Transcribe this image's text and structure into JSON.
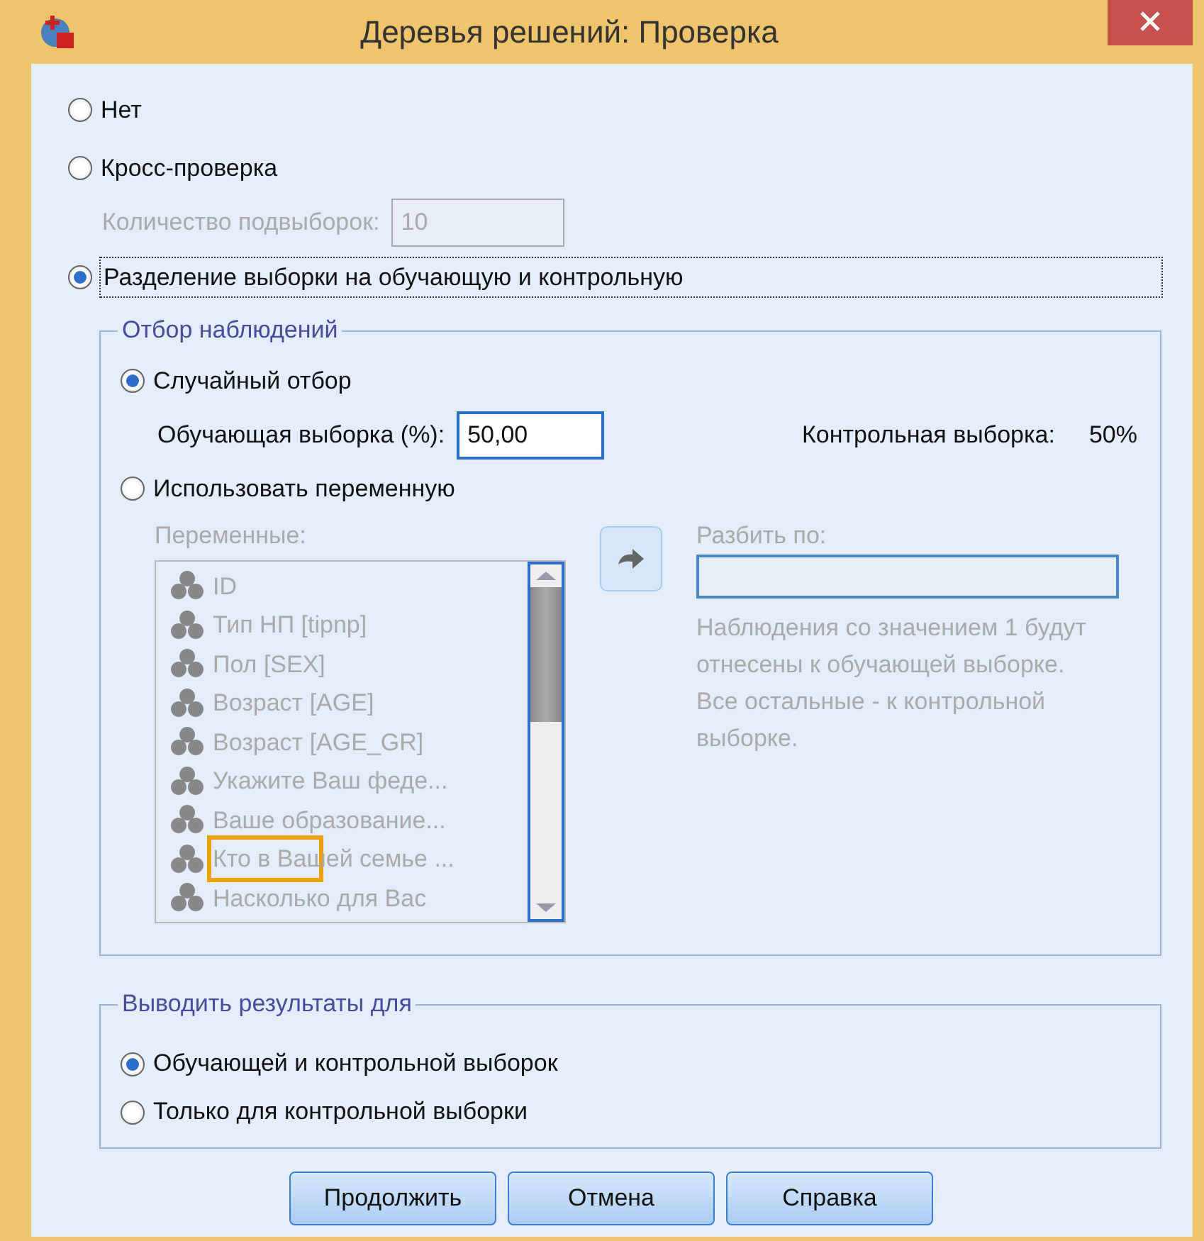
{
  "window": {
    "title": "Деревья решений: Проверка"
  },
  "validation": {
    "options": [
      {
        "label": "Нет",
        "selected": false
      },
      {
        "label": "Кросс-проверка",
        "selected": false
      },
      {
        "label": "Разделение выборки на обучающую и контрольную",
        "selected": true
      }
    ],
    "folds": {
      "label": "Количество подвыборок:",
      "value": "10",
      "disabled": true
    }
  },
  "case_selection": {
    "title": "Отбор наблюдений",
    "options": [
      {
        "label": "Случайный отбор",
        "selected": true
      },
      {
        "label": "Использовать переменную",
        "selected": false
      }
    ],
    "training": {
      "label": "Обучающая выборка (%):",
      "value": "50,00"
    },
    "test": {
      "label": "Контрольная выборка:",
      "value": "50%"
    },
    "variables": {
      "label": "Переменные:",
      "disabled": true,
      "items": [
        {
          "name": "ID",
          "highlighted": false
        },
        {
          "name": "Тип НП [tipnp]",
          "highlighted": false
        },
        {
          "name": "Пол [SEX]",
          "highlighted": false
        },
        {
          "name": "Возраст [AGE]",
          "highlighted": false
        },
        {
          "name": "Возраст [AGE_GR]",
          "highlighted": false
        },
        {
          "name": "Укажите Ваш феде...",
          "highlighted": false
        },
        {
          "name": "Ваше образование...",
          "highlighted": false
        },
        {
          "name": "Кто в Вашей семье ...",
          "highlighted": true
        },
        {
          "name": "Насколько для Вас",
          "highlighted": false
        }
      ]
    },
    "split": {
      "label": "Разбить по:",
      "disabled": true
    },
    "note": "Наблюдения со значением 1 будут отнесены к обучающей выборке.  Все остальные - к контрольной выборке."
  },
  "output": {
    "title": "Выводить результаты для",
    "options": [
      {
        "label": "Обучающей и контрольной выборок",
        "selected": true
      },
      {
        "label": "Только для контрольной выборки",
        "selected": false
      }
    ]
  },
  "buttons": [
    "Продолжить",
    "Отмена",
    "Справка"
  ]
}
